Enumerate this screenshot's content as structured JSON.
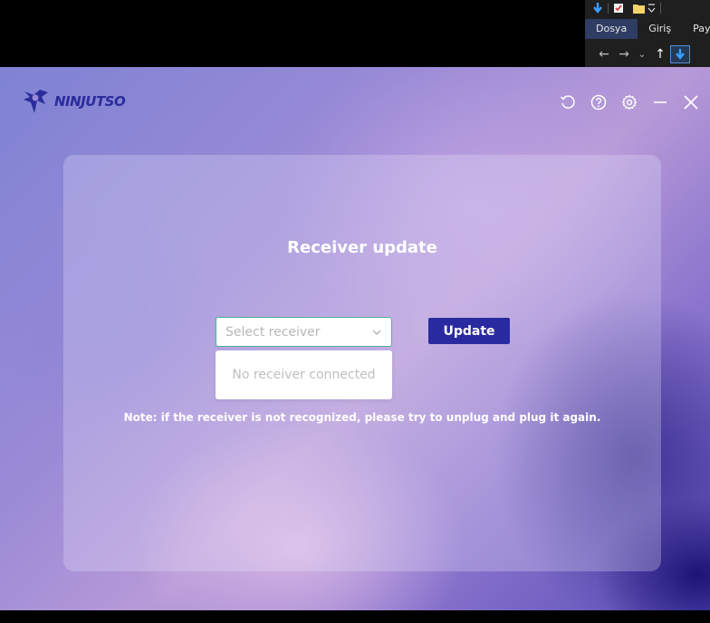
{
  "explorer": {
    "tabs": [
      "Dosya",
      "Giriş",
      "Pay"
    ],
    "active_tab": "Dosya"
  },
  "app": {
    "brand": "NINJUTSO",
    "controls": [
      {
        "name": "refresh-icon"
      },
      {
        "name": "help-icon"
      },
      {
        "name": "settings-icon"
      },
      {
        "name": "minimize-icon"
      },
      {
        "name": "close-icon"
      }
    ],
    "panel": {
      "title": "Receiver update",
      "select": {
        "placeholder": "Select receiver",
        "empty_text": "No receiver connected"
      },
      "update_label": "Update",
      "note": "Note: if the receiver is not recognized, please try to unplug and plug it again."
    },
    "colors": {
      "brand": "#2a2c9c",
      "button": "#2a2aa0",
      "select_border": "#4fae9e"
    }
  }
}
